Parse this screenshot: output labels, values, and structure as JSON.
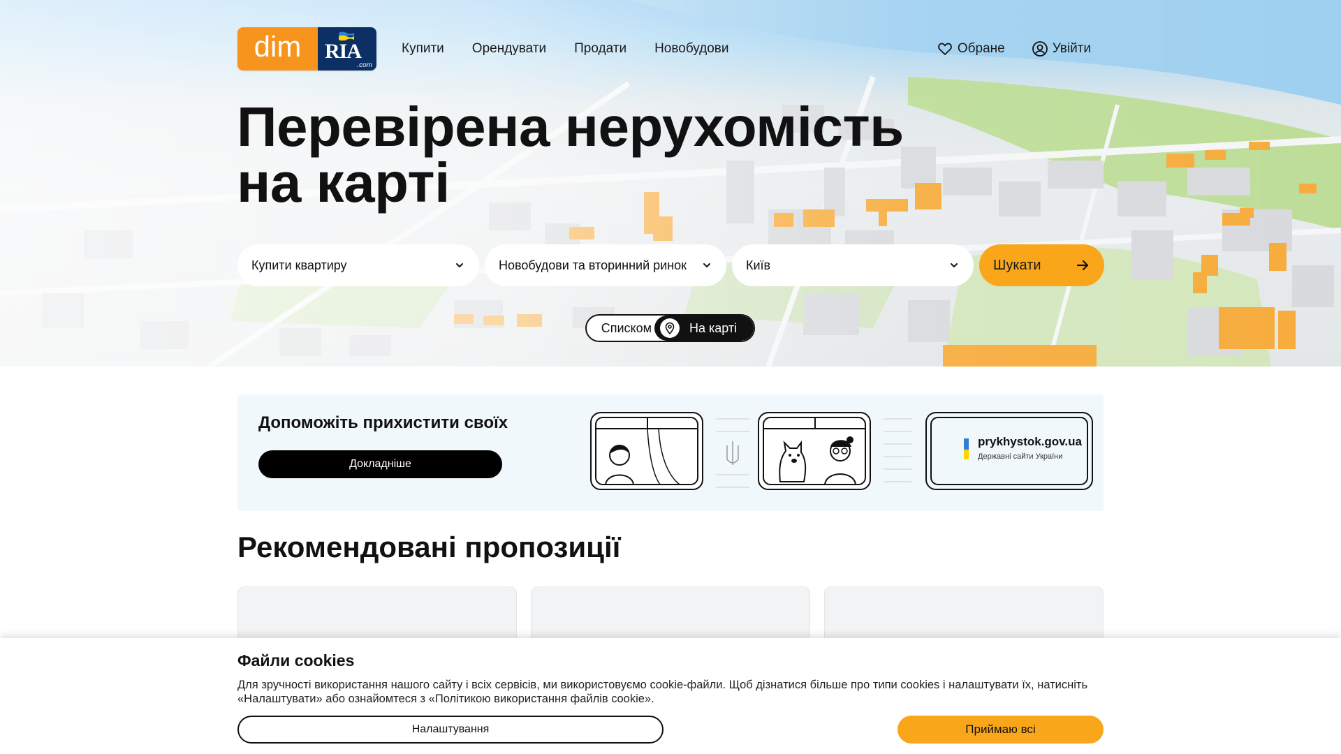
{
  "header": {
    "logo_left": "dim",
    "logo_right": "RIA",
    "logo_suffix": ".com",
    "nav": [
      "Купити",
      "Орендувати",
      "Продати",
      "Новобудови"
    ],
    "favorites_label": "Обране",
    "login_label": "Увійти"
  },
  "hero": {
    "title_line1": "Перевірена нерухомість",
    "title_line2": "на карті"
  },
  "search": {
    "operation": "Купити квартиру",
    "market": "Новобудови та вторинний ринок",
    "city": "Київ",
    "submit_label": "Шукати"
  },
  "view_toggle": {
    "list_label": "Списком",
    "map_label": "На карті",
    "active": "map"
  },
  "banner": {
    "title": "Допоможіть прихистити своїх",
    "button_label": "Докладніше",
    "site_name": "prykhystok.gov.ua",
    "site_caption": "Державні сайти України"
  },
  "recommended": {
    "title": "Рекомендовані пропозиції",
    "card_count_visible": 3
  },
  "cookie": {
    "title": "Файли cookies",
    "text": "Для зручності використання нашого сайту і всіх сервісів, ми використовуємо cookie-файли. Щоб дізнатися більше про типи cookies і налаштувати їх, натисніть «Налаштувати» або ознайомтеся з «Політикою використання файлів cookie».",
    "settings_label": "Налаштування",
    "accept_label": "Приймаю всі"
  },
  "colors": {
    "accent": "#f9a61a",
    "logo_orange": "#f7941d",
    "logo_navy": "#0c2f64",
    "dark": "#111111"
  }
}
